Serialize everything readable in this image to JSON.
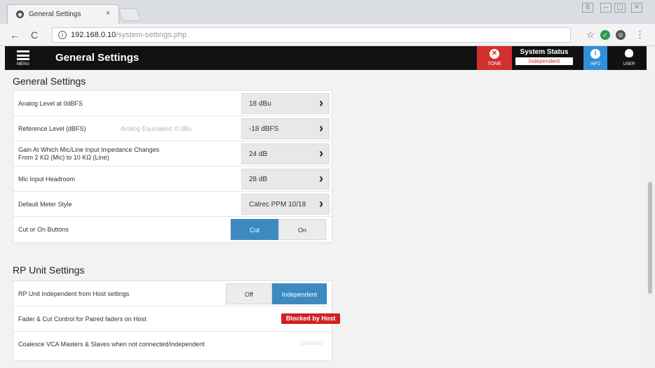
{
  "browser": {
    "tab_title": "General Settings",
    "tab_close": "×",
    "url_host": "192.168.0.10",
    "url_path": "/system-settings.php",
    "back": "←",
    "reload": "C",
    "star": "☆",
    "menu_dots": "⋮"
  },
  "header": {
    "menu_label": "MENU",
    "title": "General Settings",
    "tone_label": "TONE",
    "status_title": "System Status",
    "status_value": "Independent",
    "info_label": "INFO",
    "user_label": "USER"
  },
  "general": {
    "title": "General Settings",
    "rows": [
      {
        "label": "Analog Level at 0dBFS",
        "value": "18 dBu"
      },
      {
        "label": "Reference Level (dBFS)",
        "hint": "Analog Equivalent: 0 dBu",
        "value": "-18 dBFS"
      },
      {
        "label_line1": "Gain At Which Mic/Line Input Impedance Changes",
        "label_line2": "From 2 KΩ (Mic) to 10 KΩ (Line)",
        "value": "24 dB"
      },
      {
        "label": "Mic Input Headroom",
        "value": "28 dB"
      },
      {
        "label": "Default Meter Style",
        "value": "Calrec PPM 10/18"
      },
      {
        "label": "Cut or On Buttons",
        "option_a": "Cut",
        "option_b": "On",
        "selected": "Cut"
      }
    ]
  },
  "rp": {
    "title": "RP Unit Settings",
    "rows": [
      {
        "label": "RP Unit Independent from Host settings",
        "option_a": "Off",
        "option_b": "Independent",
        "selected": "Independent"
      },
      {
        "label": "Fader & Cut Control for Paired faders on Host",
        "badge": "Blocked by Host"
      },
      {
        "label": "Coalesce VCA Masters & Slaves when not connected/independent",
        "value": "Disabled"
      }
    ]
  },
  "colors": {
    "accent": "#3d8ac1",
    "alert": "#d42f2f",
    "info": "#2f8fd8",
    "header_bg": "#111111"
  },
  "icons": [
    "menu-icon",
    "tone-off-icon",
    "info-icon",
    "user-icon",
    "chevron-right-icon",
    "star-icon",
    "info-circle-icon"
  ]
}
